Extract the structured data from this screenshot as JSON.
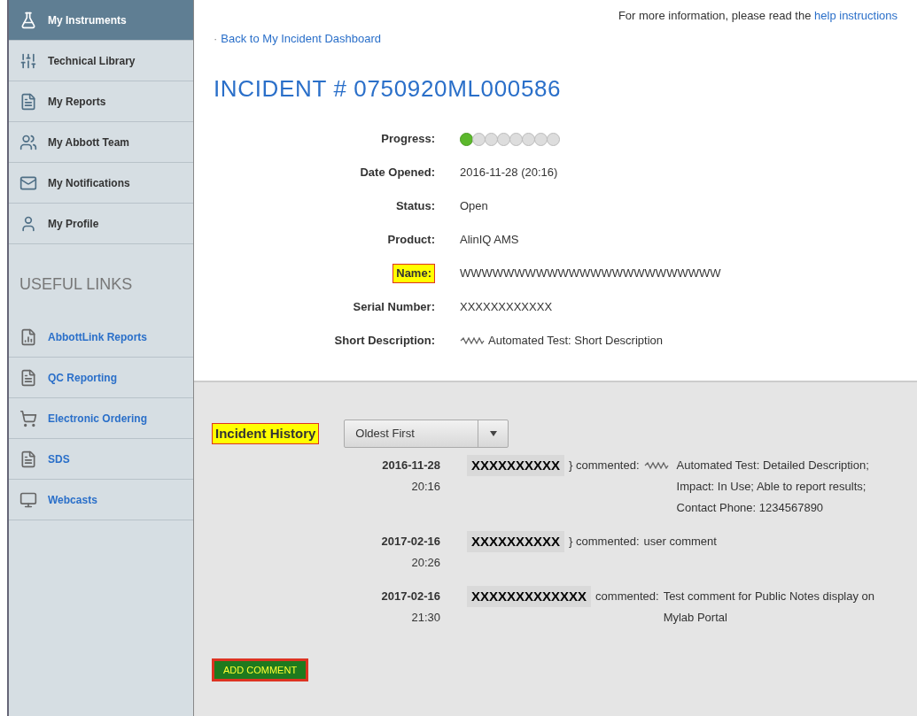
{
  "sidebar": {
    "items": [
      {
        "label": "My Instruments",
        "kind": "flask",
        "selected": true
      },
      {
        "label": "Technical Library",
        "kind": "sliders",
        "selected": false
      },
      {
        "label": "My Reports",
        "kind": "document",
        "selected": false
      },
      {
        "label": "My Abbott Team",
        "kind": "people",
        "selected": false
      },
      {
        "label": "My Notifications",
        "kind": "envelope",
        "selected": false
      },
      {
        "label": "My Profile",
        "kind": "person",
        "selected": false
      }
    ],
    "useful_links_title": "USEFUL LINKS",
    "useful_links": [
      {
        "label": "AbbottLink Reports",
        "kind": "chart"
      },
      {
        "label": "QC Reporting",
        "kind": "document"
      },
      {
        "label": "Electronic Ordering",
        "kind": "cart"
      },
      {
        "label": "SDS",
        "kind": "document"
      },
      {
        "label": "Webcasts",
        "kind": "monitor"
      }
    ]
  },
  "help": {
    "text": "For more information, please read the",
    "link": "help instructions"
  },
  "back_link": {
    "bullet": "·",
    "label": "Back to My Incident Dashboard"
  },
  "title": "INCIDENT # 0750920ML000586",
  "progress": {
    "label": "Progress:",
    "steps": [
      {
        "done": true
      },
      {
        "done": false
      },
      {
        "done": false
      },
      {
        "done": false
      },
      {
        "done": false
      },
      {
        "done": false
      },
      {
        "done": false
      },
      {
        "done": false
      }
    ]
  },
  "fields": [
    {
      "label": "Date Opened:",
      "value": "2016-11-28 (20:16)",
      "highlighted": false,
      "redacted": false
    },
    {
      "label": "Status:",
      "value": "Open",
      "highlighted": false,
      "redacted": false
    },
    {
      "label": "Product:",
      "value": "AlinIQ AMS",
      "highlighted": false,
      "redacted": false
    },
    {
      "label": "Name:",
      "value": "WWWWWWWWWWWWWWWWWWWWWWWW",
      "highlighted": true,
      "redacted": false
    },
    {
      "label": "Serial Number:",
      "value": "XXXXXXXXXXXX",
      "highlighted": false,
      "redacted": false
    },
    {
      "label": "Short Description:",
      "value": "Automated Test: Short Description",
      "highlighted": false,
      "redacted": true
    }
  ],
  "history": {
    "title": "Incident History",
    "highlighted": true,
    "sort": "Oldest First",
    "entries": [
      {
        "date": "2016-11-28",
        "time": "20:16",
        "author": "XXXXXXXXXX",
        "lead": "} commented:",
        "redacted": true,
        "comment": "Automated Test: Detailed Description; Impact: In Use; Able to report results; Contact Phone: 1234567890"
      },
      {
        "date": "2017-02-16",
        "time": "20:26",
        "author": "XXXXXXXXXX",
        "lead": "} commented:",
        "redacted": false,
        "comment": "user comment"
      },
      {
        "date": "2017-02-16",
        "time": "21:30",
        "author": "XXXXXXXXXXXXX",
        "lead": "commented:",
        "redacted": false,
        "comment": "Test comment for Public Notes display on Mylab Portal"
      }
    ]
  },
  "add_button": {
    "label": "ADD COMMENT",
    "highlighted": true
  }
}
